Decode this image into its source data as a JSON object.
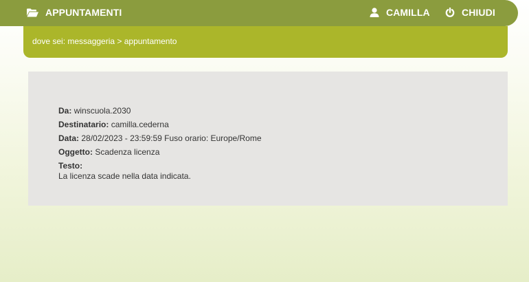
{
  "topbar": {
    "title": "APPUNTAMENTI",
    "title_icon": "folder-open-icon",
    "user": "CAMILLA",
    "user_icon": "user-icon",
    "close": "CHIUDI",
    "close_icon": "power-icon"
  },
  "breadcrumb": {
    "text": "dove sei: messaggeria > appuntamento"
  },
  "message": {
    "from_label": "Da:",
    "from_value": "winscuola.2030",
    "to_label": "Destinatario:",
    "to_value": "camilla.cederna",
    "date_label": "Data:",
    "date_value": "28/02/2023 - 23:59:59 Fuso orario: Europe/Rome",
    "subject_label": "Oggetto:",
    "subject_value": "Scadenza licenza",
    "text_label": "Testo:",
    "text_value": "La licenza scade nella data indicata."
  },
  "colors": {
    "topbar": "#8b9c3e",
    "breadcrumb_bar": "#abb62a",
    "panel": "#e6e5e3",
    "page_top": "#ffffff",
    "page_bottom": "#e6eec8"
  }
}
